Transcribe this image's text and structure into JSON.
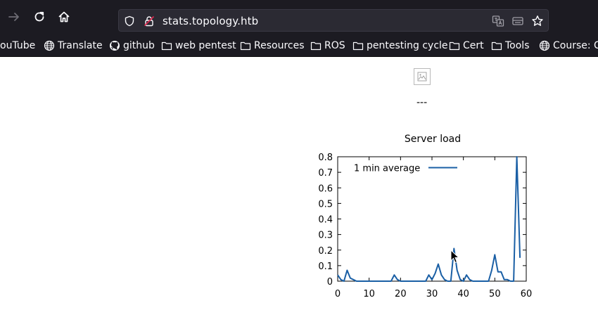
{
  "browser": {
    "url": "stats.topology.htb"
  },
  "bookmarks": [
    {
      "label": "ouTube",
      "icon": "none"
    },
    {
      "label": "Translate",
      "icon": "globe-icon"
    },
    {
      "label": "github",
      "icon": "github-icon"
    },
    {
      "label": "web pentest",
      "icon": "folder-icon"
    },
    {
      "label": "Resources",
      "icon": "folder-icon"
    },
    {
      "label": "ROS",
      "icon": "folder-icon"
    },
    {
      "label": "pentesting cycle",
      "icon": "folder-icon"
    },
    {
      "label": "Cert",
      "icon": "folder-icon"
    },
    {
      "label": "Tools",
      "icon": "folder-icon"
    },
    {
      "label": "Course: C",
      "icon": "globe-icon"
    }
  ],
  "page": {
    "separator": "---"
  },
  "chart_data": {
    "type": "line",
    "title": "Server load",
    "xlabel": "",
    "ylabel": "",
    "xlim": [
      0,
      60
    ],
    "ylim": [
      0,
      0.8
    ],
    "xticks": [
      "0",
      "10",
      "20",
      "30",
      "40",
      "50",
      "60"
    ],
    "yticks": [
      "0",
      "0.1",
      "0.2",
      "0.3",
      "0.4",
      "0.5",
      "0.6",
      "0.7",
      "0.8"
    ],
    "legend_position": "top-left",
    "grid": false,
    "series_color": "#1a5fa5",
    "series": [
      {
        "name": "1 min average",
        "x": [
          0,
          1,
          2,
          3,
          4,
          5,
          6,
          8,
          10,
          12,
          14,
          16,
          17,
          18,
          19,
          20,
          22,
          24,
          26,
          28,
          29,
          30,
          31,
          32,
          33,
          34,
          35,
          36,
          37,
          38,
          39,
          40,
          41,
          42,
          43,
          44,
          46,
          48,
          49,
          50,
          51,
          52,
          53,
          54,
          55,
          56,
          57,
          58
        ],
        "y": [
          0.04,
          0.01,
          0.0,
          0.07,
          0.02,
          0.01,
          0.0,
          0.0,
          0.0,
          0.0,
          0.0,
          0.0,
          0.0,
          0.04,
          0.01,
          0.0,
          0.0,
          0.0,
          0.0,
          0.0,
          0.04,
          0.01,
          0.05,
          0.11,
          0.04,
          0.01,
          0.0,
          0.0,
          0.21,
          0.07,
          0.01,
          0.0,
          0.04,
          0.01,
          0.0,
          0.0,
          0.0,
          0.0,
          0.07,
          0.17,
          0.06,
          0.06,
          0.01,
          0.01,
          0.0,
          0.0,
          0.8,
          0.15
        ]
      }
    ]
  }
}
